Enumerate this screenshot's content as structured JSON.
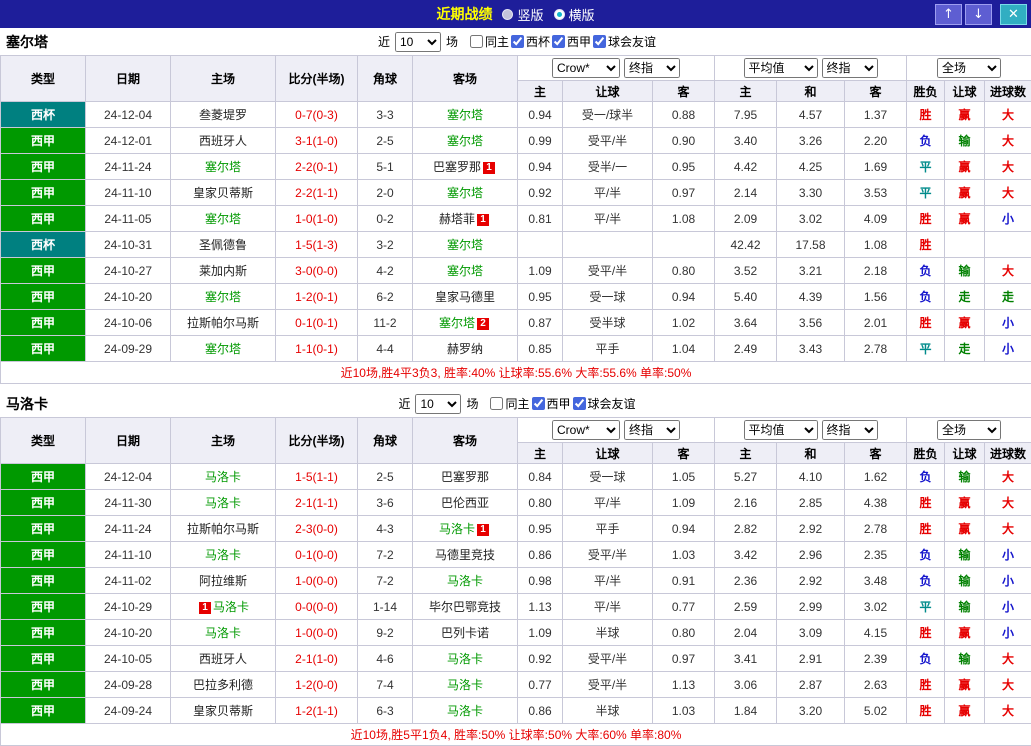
{
  "titlebar": {
    "title": "近期战绩",
    "layout_options": [
      {
        "label": "竖版",
        "selected": false
      },
      {
        "label": "横版",
        "selected": true
      }
    ],
    "up_icon": "↑",
    "down_icon": "↓",
    "close_icon": "✕"
  },
  "colors": {
    "titlebar_bg": "#1e1e9a",
    "title_text": "#ffff00",
    "league": {
      "西甲": "#009900",
      "西杯": "#008080"
    },
    "focus_team": "#009900",
    "opponent_team": "#222222",
    "score": "#e60000",
    "result_win": "#e60000",
    "result_draw": "#008b8b",
    "result_loss": "#1515cc",
    "handicap_win": "#e60000",
    "handicap_lose": "#008000",
    "push": "#008000",
    "goals_over": "#e60000",
    "goals_under": "#1515cc",
    "summary_text": "#e60000",
    "redcard_bg": "#e60000"
  },
  "sections": [
    {
      "team": "塞尔塔",
      "filter": {
        "prefix": "近",
        "count": "10",
        "suffix": "场",
        "checkboxes": [
          {
            "label": "同主",
            "checked": false
          },
          {
            "label": "西杯",
            "checked": true
          },
          {
            "label": "西甲",
            "checked": true
          },
          {
            "label": "球会友谊",
            "checked": true
          }
        ]
      },
      "selects": {
        "bookmaker": "Crow*",
        "bookmaker_time": "终指",
        "average": "平均值",
        "average_time": "终指",
        "scope": "全场"
      },
      "columns": [
        "类型",
        "日期",
        "主场",
        "比分(半场)",
        "角球",
        "客场",
        "主",
        "让球",
        "客",
        "主",
        "和",
        "客",
        "胜负",
        "让球",
        "进球数"
      ],
      "rows": [
        {
          "league": "西杯",
          "date": "24-12-04",
          "home": "叁菱堤罗",
          "home_focus": false,
          "home_badge": "",
          "score": "0-7(0-3)",
          "corner": "3-3",
          "away": "塞尔塔",
          "away_focus": true,
          "away_badge": "",
          "odds": [
            "0.94",
            "受一/球半",
            "0.88"
          ],
          "avg": [
            "7.95",
            "4.57",
            "1.37"
          ],
          "result": "胜",
          "handicap": "赢",
          "goals": "大"
        },
        {
          "league": "西甲",
          "date": "24-12-01",
          "home": "西班牙人",
          "home_focus": false,
          "home_badge": "",
          "score": "3-1(1-0)",
          "corner": "2-5",
          "away": "塞尔塔",
          "away_focus": true,
          "away_badge": "",
          "odds": [
            "0.99",
            "受平/半",
            "0.90"
          ],
          "avg": [
            "3.40",
            "3.26",
            "2.20"
          ],
          "result": "负",
          "handicap": "输",
          "goals": "大"
        },
        {
          "league": "西甲",
          "date": "24-11-24",
          "home": "塞尔塔",
          "home_focus": true,
          "home_badge": "",
          "score": "2-2(0-1)",
          "corner": "5-1",
          "away": "巴塞罗那",
          "away_focus": false,
          "away_badge": "1",
          "odds": [
            "0.94",
            "受半/一",
            "0.95"
          ],
          "avg": [
            "4.42",
            "4.25",
            "1.69"
          ],
          "result": "平",
          "handicap": "赢",
          "goals": "大"
        },
        {
          "league": "西甲",
          "date": "24-11-10",
          "home": "皇家贝蒂斯",
          "home_focus": false,
          "home_badge": "",
          "score": "2-2(1-1)",
          "corner": "2-0",
          "away": "塞尔塔",
          "away_focus": true,
          "away_badge": "",
          "odds": [
            "0.92",
            "平/半",
            "0.97"
          ],
          "avg": [
            "2.14",
            "3.30",
            "3.53"
          ],
          "result": "平",
          "handicap": "赢",
          "goals": "大"
        },
        {
          "league": "西甲",
          "date": "24-11-05",
          "home": "塞尔塔",
          "home_focus": true,
          "home_badge": "",
          "score": "1-0(1-0)",
          "corner": "0-2",
          "away": "赫塔菲",
          "away_focus": false,
          "away_badge": "1",
          "odds": [
            "0.81",
            "平/半",
            "1.08"
          ],
          "avg": [
            "2.09",
            "3.02",
            "4.09"
          ],
          "result": "胜",
          "handicap": "赢",
          "goals": "小"
        },
        {
          "league": "西杯",
          "date": "24-10-31",
          "home": "圣佩德鲁",
          "home_focus": false,
          "home_badge": "",
          "score": "1-5(1-3)",
          "corner": "3-2",
          "away": "塞尔塔",
          "away_focus": true,
          "away_badge": "",
          "odds": [
            "",
            "",
            ""
          ],
          "avg": [
            "42.42",
            "17.58",
            "1.08"
          ],
          "result": "胜",
          "handicap": "",
          "goals": ""
        },
        {
          "league": "西甲",
          "date": "24-10-27",
          "home": "莱加内斯",
          "home_focus": false,
          "home_badge": "",
          "score": "3-0(0-0)",
          "corner": "4-2",
          "away": "塞尔塔",
          "away_focus": true,
          "away_badge": "",
          "odds": [
            "1.09",
            "受平/半",
            "0.80"
          ],
          "avg": [
            "3.52",
            "3.21",
            "2.18"
          ],
          "result": "负",
          "handicap": "输",
          "goals": "大"
        },
        {
          "league": "西甲",
          "date": "24-10-20",
          "home": "塞尔塔",
          "home_focus": true,
          "home_badge": "",
          "score": "1-2(0-1)",
          "corner": "6-2",
          "away": "皇家马德里",
          "away_focus": false,
          "away_badge": "",
          "odds": [
            "0.95",
            "受一球",
            "0.94"
          ],
          "avg": [
            "5.40",
            "4.39",
            "1.56"
          ],
          "result": "负",
          "handicap": "走",
          "goals": "走"
        },
        {
          "league": "西甲",
          "date": "24-10-06",
          "home": "拉斯帕尔马斯",
          "home_focus": false,
          "home_badge": "",
          "score": "0-1(0-1)",
          "corner": "11-2",
          "away": "塞尔塔",
          "away_focus": true,
          "away_badge": "2",
          "odds": [
            "0.87",
            "受半球",
            "1.02"
          ],
          "avg": [
            "3.64",
            "3.56",
            "2.01"
          ],
          "result": "胜",
          "handicap": "赢",
          "goals": "小"
        },
        {
          "league": "西甲",
          "date": "24-09-29",
          "home": "塞尔塔",
          "home_focus": true,
          "home_badge": "",
          "score": "1-1(0-1)",
          "corner": "4-4",
          "away": "赫罗纳",
          "away_focus": false,
          "away_badge": "",
          "odds": [
            "0.85",
            "平手",
            "1.04"
          ],
          "avg": [
            "2.49",
            "3.43",
            "2.78"
          ],
          "result": "平",
          "handicap": "走",
          "goals": "小"
        }
      ],
      "summary": "近10场,胜4平3负3, 胜率:40% 让球率:55.6% 大率:55.6% 单率:50%"
    },
    {
      "team": "马洛卡",
      "filter": {
        "prefix": "近",
        "count": "10",
        "suffix": "场",
        "checkboxes": [
          {
            "label": "同主",
            "checked": false
          },
          {
            "label": "西甲",
            "checked": true
          },
          {
            "label": "球会友谊",
            "checked": true
          }
        ]
      },
      "selects": {
        "bookmaker": "Crow*",
        "bookmaker_time": "终指",
        "average": "平均值",
        "average_time": "终指",
        "scope": "全场"
      },
      "columns": [
        "类型",
        "日期",
        "主场",
        "比分(半场)",
        "角球",
        "客场",
        "主",
        "让球",
        "客",
        "主",
        "和",
        "客",
        "胜负",
        "让球",
        "进球数"
      ],
      "rows": [
        {
          "league": "西甲",
          "date": "24-12-04",
          "home": "马洛卡",
          "home_focus": true,
          "home_badge": "",
          "score": "1-5(1-1)",
          "corner": "2-5",
          "away": "巴塞罗那",
          "away_focus": false,
          "away_badge": "",
          "odds": [
            "0.84",
            "受一球",
            "1.05"
          ],
          "avg": [
            "5.27",
            "4.10",
            "1.62"
          ],
          "result": "负",
          "handicap": "输",
          "goals": "大"
        },
        {
          "league": "西甲",
          "date": "24-11-30",
          "home": "马洛卡",
          "home_focus": true,
          "home_badge": "",
          "score": "2-1(1-1)",
          "corner": "3-6",
          "away": "巴伦西亚",
          "away_focus": false,
          "away_badge": "",
          "odds": [
            "0.80",
            "平/半",
            "1.09"
          ],
          "avg": [
            "2.16",
            "2.85",
            "4.38"
          ],
          "result": "胜",
          "handicap": "赢",
          "goals": "大"
        },
        {
          "league": "西甲",
          "date": "24-11-24",
          "home": "拉斯帕尔马斯",
          "home_focus": false,
          "home_badge": "",
          "score": "2-3(0-0)",
          "corner": "4-3",
          "away": "马洛卡",
          "away_focus": true,
          "away_badge": "1",
          "odds": [
            "0.95",
            "平手",
            "0.94"
          ],
          "avg": [
            "2.82",
            "2.92",
            "2.78"
          ],
          "result": "胜",
          "handicap": "赢",
          "goals": "大"
        },
        {
          "league": "西甲",
          "date": "24-11-10",
          "home": "马洛卡",
          "home_focus": true,
          "home_badge": "",
          "score": "0-1(0-0)",
          "corner": "7-2",
          "away": "马德里竞技",
          "away_focus": false,
          "away_badge": "",
          "odds": [
            "0.86",
            "受平/半",
            "1.03"
          ],
          "avg": [
            "3.42",
            "2.96",
            "2.35"
          ],
          "result": "负",
          "handicap": "输",
          "goals": "小"
        },
        {
          "league": "西甲",
          "date": "24-11-02",
          "home": "阿拉维斯",
          "home_focus": false,
          "home_badge": "",
          "score": "1-0(0-0)",
          "corner": "7-2",
          "away": "马洛卡",
          "away_focus": true,
          "away_badge": "",
          "odds": [
            "0.98",
            "平/半",
            "0.91"
          ],
          "avg": [
            "2.36",
            "2.92",
            "3.48"
          ],
          "result": "负",
          "handicap": "输",
          "goals": "小"
        },
        {
          "league": "西甲",
          "date": "24-10-29",
          "home": "马洛卡",
          "home_focus": true,
          "home_badge": "1",
          "score": "0-0(0-0)",
          "corner": "1-14",
          "away": "毕尔巴鄂竞技",
          "away_focus": false,
          "away_badge": "",
          "odds": [
            "1.13",
            "平/半",
            "0.77"
          ],
          "avg": [
            "2.59",
            "2.99",
            "3.02"
          ],
          "result": "平",
          "handicap": "输",
          "goals": "小"
        },
        {
          "league": "西甲",
          "date": "24-10-20",
          "home": "马洛卡",
          "home_focus": true,
          "home_badge": "",
          "score": "1-0(0-0)",
          "corner": "9-2",
          "away": "巴列卡诺",
          "away_focus": false,
          "away_badge": "",
          "odds": [
            "1.09",
            "半球",
            "0.80"
          ],
          "avg": [
            "2.04",
            "3.09",
            "4.15"
          ],
          "result": "胜",
          "handicap": "赢",
          "goals": "小"
        },
        {
          "league": "西甲",
          "date": "24-10-05",
          "home": "西班牙人",
          "home_focus": false,
          "home_badge": "",
          "score": "2-1(1-0)",
          "corner": "4-6",
          "away": "马洛卡",
          "away_focus": true,
          "away_badge": "",
          "odds": [
            "0.92",
            "受平/半",
            "0.97"
          ],
          "avg": [
            "3.41",
            "2.91",
            "2.39"
          ],
          "result": "负",
          "handicap": "输",
          "goals": "大"
        },
        {
          "league": "西甲",
          "date": "24-09-28",
          "home": "巴拉多利德",
          "home_focus": false,
          "home_badge": "",
          "score": "1-2(0-0)",
          "corner": "7-4",
          "away": "马洛卡",
          "away_focus": true,
          "away_badge": "",
          "odds": [
            "0.77",
            "受平/半",
            "1.13"
          ],
          "avg": [
            "3.06",
            "2.87",
            "2.63"
          ],
          "result": "胜",
          "handicap": "赢",
          "goals": "大"
        },
        {
          "league": "西甲",
          "date": "24-09-24",
          "home": "皇家贝蒂斯",
          "home_focus": false,
          "home_badge": "",
          "score": "1-2(1-1)",
          "corner": "6-3",
          "away": "马洛卡",
          "away_focus": true,
          "away_badge": "",
          "odds": [
            "0.86",
            "半球",
            "1.03"
          ],
          "avg": [
            "1.84",
            "3.20",
            "5.02"
          ],
          "result": "胜",
          "handicap": "赢",
          "goals": "大"
        }
      ],
      "summary": "近10场,胜5平1负4, 胜率:50% 让球率:50% 大率:60% 单率:80%"
    }
  ]
}
